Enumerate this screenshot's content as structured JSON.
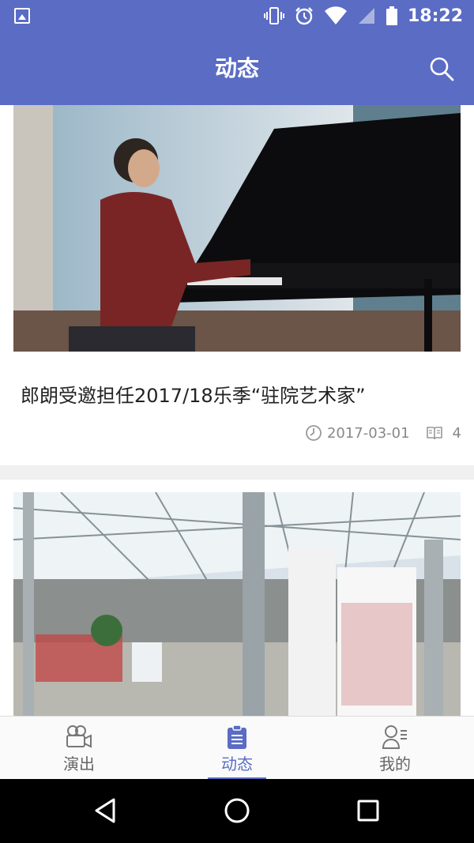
{
  "status_bar": {
    "time": "18:22",
    "icons": [
      "image-icon",
      "vibrate-icon",
      "alarm-icon",
      "wifi-icon",
      "signal-icon",
      "battery-icon"
    ]
  },
  "app_bar": {
    "title": "动态",
    "search_icon": "search-icon"
  },
  "feed": [
    {
      "title": "郎朗受邀担任2017/18乐季“驻院艺术家”",
      "date": "2017-03-01",
      "count": "4"
    },
    {
      "title": "",
      "date": "",
      "count": ""
    }
  ],
  "bottom_nav": {
    "tabs": [
      {
        "label": "演出",
        "icon": "camera-icon",
        "active": false
      },
      {
        "label": "动态",
        "icon": "clipboard-icon",
        "active": true
      },
      {
        "label": "我的",
        "icon": "user-list-icon",
        "active": false
      }
    ]
  },
  "colors": {
    "accent": "#5a6cc4"
  }
}
